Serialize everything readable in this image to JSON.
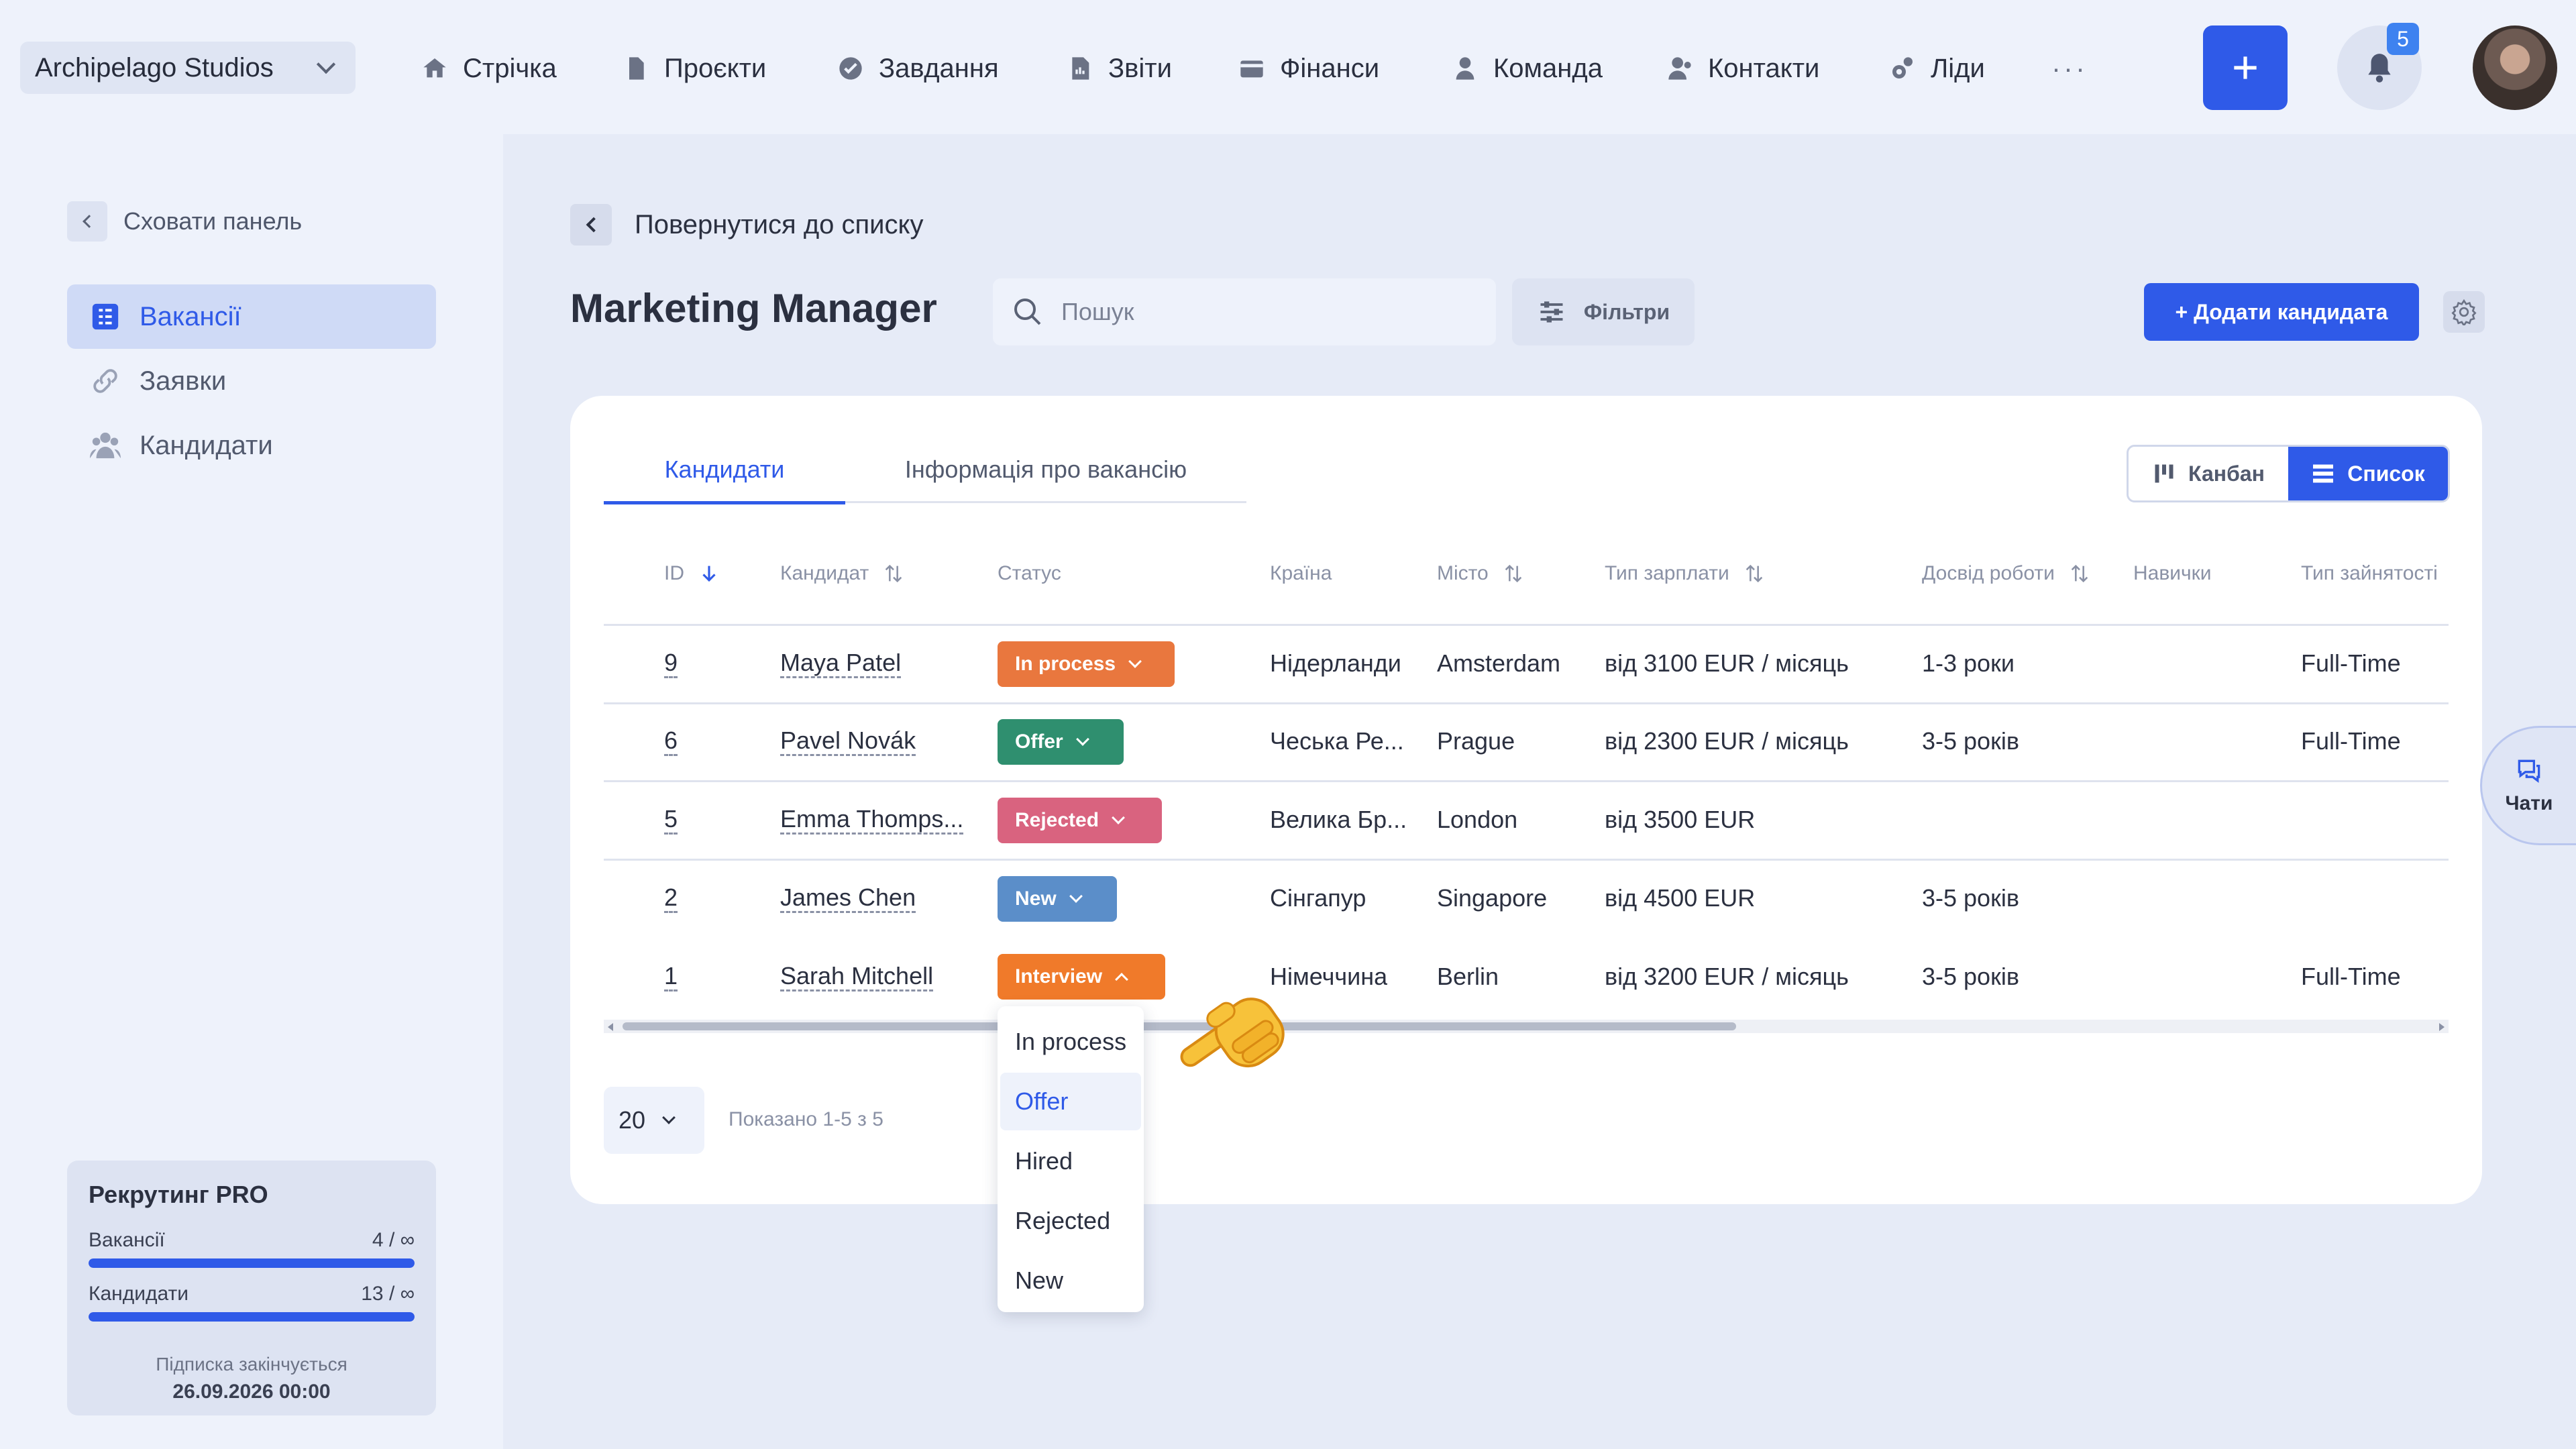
{
  "topbar": {
    "company": "Archipelago Studios",
    "nav": [
      {
        "label": "Стрічка",
        "icon": "home-icon"
      },
      {
        "label": "Проєкти",
        "icon": "document-icon"
      },
      {
        "label": "Завдання",
        "icon": "check-circle-icon"
      },
      {
        "label": "Звіти",
        "icon": "report-icon"
      },
      {
        "label": "Фінанси",
        "icon": "wallet-icon"
      },
      {
        "label": "Команда",
        "icon": "user-icon"
      },
      {
        "label": "Контакти",
        "icon": "contacts-icon"
      },
      {
        "label": "Ліди",
        "icon": "leads-icon"
      }
    ],
    "more": "···",
    "notifications_count": "5"
  },
  "sidebar": {
    "hide_label": "Сховати панель",
    "items": [
      {
        "label": "Вакансії",
        "icon": "vacancies-icon",
        "active": true
      },
      {
        "label": "Заявки",
        "icon": "link-icon",
        "active": false
      },
      {
        "label": "Кандидати",
        "icon": "people-icon",
        "active": false
      }
    ],
    "plan": {
      "title": "Рекрутинг PRO",
      "usage": [
        {
          "label": "Вакансії",
          "value": "4 / ∞",
          "fill": 1.0
        },
        {
          "label": "Кандидати",
          "value": "13 / ∞",
          "fill": 1.0
        }
      ],
      "expires_label": "Підписка закінчується",
      "expires_date": "26.09.2026 00:00"
    }
  },
  "main": {
    "back_label": "Повернутися до списку",
    "title": "Marketing Manager",
    "search_placeholder": "Пошук",
    "filters_label": "Фільтри",
    "add_candidate_label": "+ Додати кандидата",
    "tabs": [
      {
        "label": "Кандидати",
        "active": true
      },
      {
        "label": "Інформація про вакансію",
        "active": false
      }
    ],
    "view_toggle": [
      {
        "label": "Канбан",
        "active": false
      },
      {
        "label": "Список",
        "active": true
      }
    ],
    "columns": [
      "ID",
      "Кандидат",
      "Статус",
      "Країна",
      "Місто",
      "Тип зарплати",
      "Досвід роботи",
      "Навички",
      "Тип зайнятості"
    ],
    "rows": [
      {
        "id": "9",
        "name": "Maya Patel",
        "status": "In process",
        "status_color": "#e9773e",
        "country": "Нідерланди",
        "city": "Amsterdam",
        "salary": "від 3100 EUR / місяць",
        "experience": "1-3 роки",
        "skills": "",
        "employment": "Full-Time"
      },
      {
        "id": "6",
        "name": "Pavel Novák",
        "status": "Offer",
        "status_color": "#2f8f6f",
        "country": "Чеська Ре...",
        "city": "Prague",
        "salary": "від 2300 EUR / місяць",
        "experience": "3-5 років",
        "skills": "",
        "employment": "Full-Time"
      },
      {
        "id": "5",
        "name": "Emma Thomps...",
        "status": "Rejected",
        "status_color": "#d9637f",
        "country": "Велика Бр...",
        "city": "London",
        "salary": "від 3500 EUR",
        "experience": "",
        "skills": "",
        "employment": ""
      },
      {
        "id": "2",
        "name": "James Chen",
        "status": "New",
        "status_color": "#5b8ec9",
        "country": "Сінгапур",
        "city": "Singapore",
        "salary": "від 4500 EUR",
        "experience": "3-5 років",
        "skills": "",
        "employment": ""
      },
      {
        "id": "1",
        "name": "Sarah Mitchell",
        "status": "Interview",
        "status_color": "#f07a2a",
        "country": "Німеччина",
        "city": "Berlin",
        "salary": "від 3200 EUR / місяць",
        "experience": "3-5 років",
        "skills": "",
        "employment": "Full-Time"
      }
    ],
    "per_page": "20",
    "shown_label": "Показано 1-5 з 5"
  },
  "status_dropdown": {
    "options": [
      "In process",
      "Offer",
      "Hired",
      "Rejected",
      "New"
    ],
    "hovered": "Offer"
  },
  "chat": {
    "label": "Чати"
  },
  "colors": {
    "accent": "#2f5ae8",
    "background": "#e6ebf7"
  }
}
